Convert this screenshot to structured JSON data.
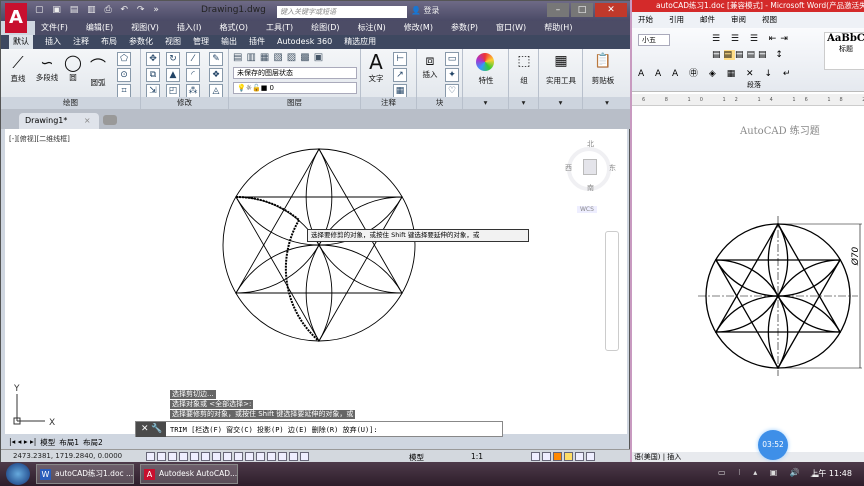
{
  "autocad": {
    "file_title": "Drawing1.dwg",
    "search_placeholder": "键入关键字或短语",
    "login": "登录",
    "menu": [
      "文件(F)",
      "编辑(E)",
      "视图(V)",
      "插入(I)",
      "格式(O)",
      "工具(T)",
      "绘图(D)",
      "标注(N)",
      "修改(M)",
      "参数(P)",
      "窗口(W)",
      "帮助(H)"
    ],
    "ribbon_tabs": [
      "默认",
      "插入",
      "注释",
      "布局",
      "参数化",
      "视图",
      "管理",
      "输出",
      "插件",
      "Autodesk 360",
      "精选应用"
    ],
    "draw_tools": [
      "直线",
      "多段线",
      "圆",
      "圆弧"
    ],
    "panels": {
      "draw": "绘图",
      "modify": "修改",
      "layers": "图层",
      "annotation": "注释",
      "block": "块",
      "properties": "特性",
      "group": "组",
      "utilities": "实用工具",
      "clipboard": "剪贴板"
    },
    "text_tool": "文字",
    "insert_tool": "插入",
    "layer_state": "未保存的图层状态",
    "current_layer": "0",
    "doc_tab": "Drawing1*",
    "viewport_label": "[-][俯视][二维线框]",
    "viewcube": {
      "north": "北",
      "south": "南",
      "east": "东",
      "west": "西",
      "ucs": "WCS"
    },
    "tooltip": "选择要修剪的对象，或按住 Shift 键选择要延伸的对象，或",
    "history": [
      "选择剪切边...",
      "选择对象或 <全部选择>:",
      "选择要修剪的对象，或按住 Shift 键选择要延伸的对象，或"
    ],
    "command": "TRIM [栏选(F) 窗交(C) 投影(P) 边(E) 删除(R) 放弃(U)]:",
    "layout_tabs": [
      "模型",
      "布局1",
      "布局2"
    ],
    "coordinates": "2473.2381, 1719.2840, 0.0000",
    "status_model": "模型",
    "annotation_scale": "1:1",
    "ucs_axes": {
      "x": "X",
      "y": "Y"
    }
  },
  "word": {
    "title": "autoCAD练习1.doc [兼容模式] - Microsoft Word(产品激活失败)",
    "tabs": [
      "开始",
      "引用",
      "邮件",
      "审阅",
      "视图"
    ],
    "font_size": "小五",
    "style_sample": "AaBbC",
    "style_name": "标题",
    "paragraph_group": "段落",
    "ruler": "6 8 10 12 14 16 18 20 22",
    "doc_heading": "AutoCAD 练习题",
    "dimension": "Ø70",
    "status_lang": "语(美国)",
    "status_insert": "插入"
  },
  "timer": "03:52",
  "taskbar": {
    "items": [
      "autoCAD练习1.doc ...",
      "Autodesk AutoCAD..."
    ],
    "clock": "上午 11:48"
  },
  "colors": {
    "autocad_red": "#c8102e",
    "word_title": "#d42a2a",
    "timer": "#3e8fe8"
  }
}
